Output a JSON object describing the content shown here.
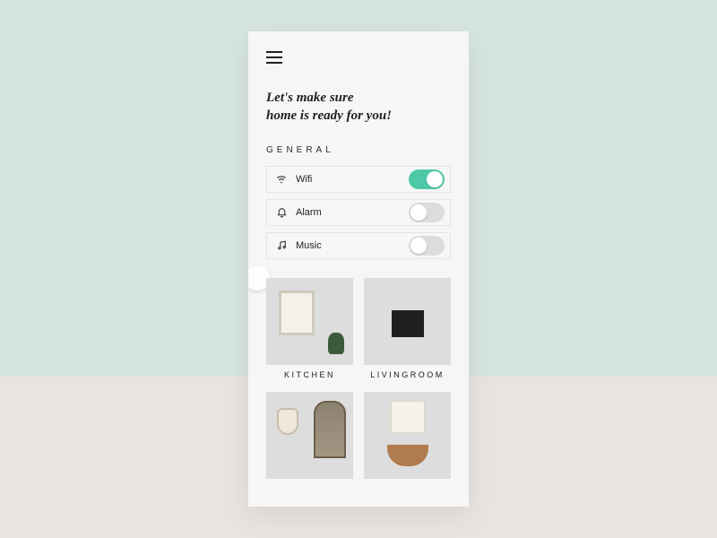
{
  "heading_line1": "Let's make sure",
  "heading_line2": "home is ready for you!",
  "section_label": "GENERAL",
  "toggles": [
    {
      "icon": "wifi",
      "label": "Wifi",
      "on": true
    },
    {
      "icon": "bell",
      "label": "Alarm",
      "on": false
    },
    {
      "icon": "music",
      "label": "Music",
      "on": false
    }
  ],
  "rooms": [
    {
      "name": "KITCHEN",
      "style": "kitchen"
    },
    {
      "name": "LIVINGROOM",
      "style": "living"
    },
    {
      "name": "",
      "style": "bedroom"
    },
    {
      "name": "",
      "style": "bath"
    }
  ],
  "colors": {
    "accent": "#4ec9a7"
  }
}
